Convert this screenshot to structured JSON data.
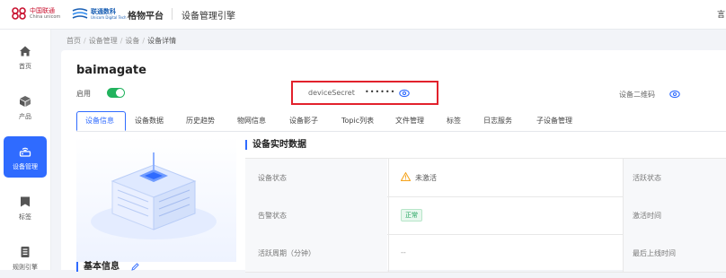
{
  "header": {
    "brand1_cn": "中国联通",
    "brand1_en": "China unicom",
    "brand2_cn": "联通数科",
    "brand2_en": "Unicom Digital Tech",
    "platform": "格物平台",
    "module": "设备管理引擎",
    "user": "言"
  },
  "sidebar": {
    "items": [
      {
        "label": "首页",
        "icon": "home-icon"
      },
      {
        "label": "产品",
        "icon": "cube-icon"
      },
      {
        "label": "设备管理",
        "icon": "router-icon",
        "active": true
      },
      {
        "label": "标签",
        "icon": "tag-icon"
      },
      {
        "label": "规则引擎",
        "icon": "document-icon"
      }
    ]
  },
  "breadcrumb": [
    "首页",
    "设备管理",
    "设备",
    "设备详情"
  ],
  "device": {
    "name": "baimagate",
    "enabled_label": "启用",
    "secret_label": "deviceSecret",
    "secret_value": "••••••",
    "qr_label": "设备二维码"
  },
  "tabs": [
    "设备信息",
    "设备数据",
    "历史趋势",
    "物网信息",
    "设备影子",
    "Topic列表",
    "文件管理",
    "标签",
    "日志服务",
    "子设备管理"
  ],
  "realtime": {
    "title": "设备实时数据",
    "rows": [
      {
        "key": "设备状态",
        "value": "未激活",
        "key2": "活跃状态"
      },
      {
        "key": "告警状态",
        "value": "正常",
        "key2": "激活时间"
      },
      {
        "key": "活跃周期（分钟）",
        "value": "--",
        "key2": "最后上线时间"
      }
    ]
  },
  "basic_title": "基本信息",
  "colors": {
    "primary": "#2f6bff",
    "success": "#22b35e",
    "highlight_border": "#e2212c",
    "warning": "#f5a623"
  }
}
